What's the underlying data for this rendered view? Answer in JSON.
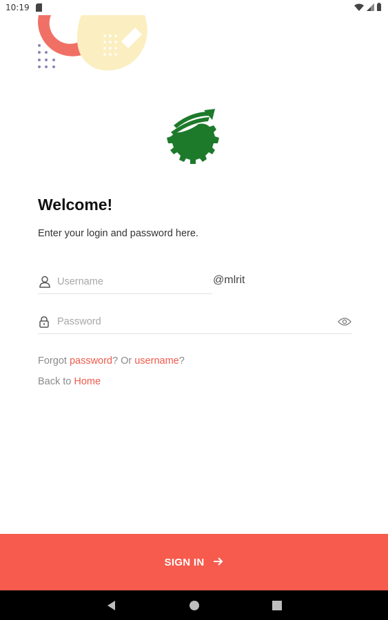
{
  "status_bar": {
    "time": "10:19",
    "icons": [
      "sd-card-icon",
      "wifi-icon",
      "signal-icon",
      "battery-icon"
    ]
  },
  "header": {
    "title": "Welcome!",
    "subtitle": "Enter your login and password here."
  },
  "form": {
    "username": {
      "placeholder": "Username",
      "value": "",
      "suffix": "@mlrit",
      "icon": "user-icon"
    },
    "password": {
      "placeholder": "Password",
      "value": "",
      "icon": "lock-icon",
      "toggle_icon": "eye-icon"
    }
  },
  "help": {
    "forgot_prefix": "Forgot ",
    "password_link": "password",
    "or_text": "? Or ",
    "username_link": "username",
    "question_mark": "?",
    "back_prefix": "Back to ",
    "home_link": "Home"
  },
  "signin": {
    "label": "SIGN IN",
    "icon": "arrow-right-icon"
  },
  "nav": {
    "icons": [
      "back-icon",
      "home-icon",
      "recents-icon"
    ]
  },
  "colors": {
    "accent": "#f65b4d",
    "link": "#ee5a4c",
    "logo_green": "#1e7a2b",
    "decor_yellow": "#fbeec0",
    "decor_coral": "#f07066",
    "decor_dots": "#8a85b8"
  }
}
